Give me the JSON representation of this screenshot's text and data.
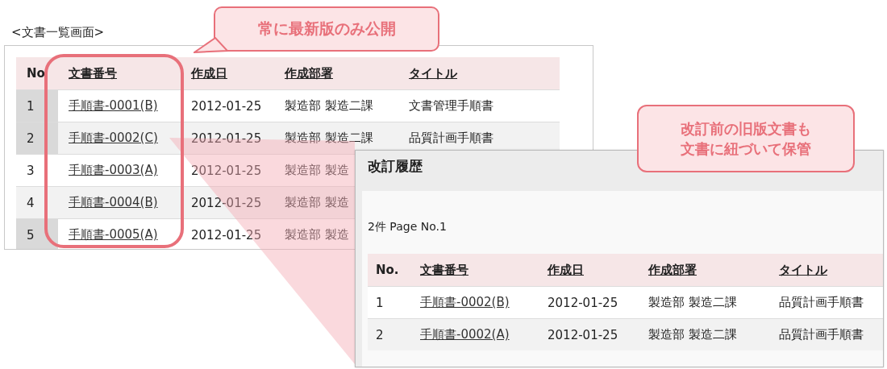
{
  "page_title": "<文書一覧画面>",
  "document_list": {
    "columns": [
      "No",
      "文書番号",
      "作成日",
      "作成部署",
      "タイトル"
    ],
    "rows": [
      {
        "no": "1",
        "doc_number": "手順書-0001(B)",
        "date": "2012-01-25",
        "department": "製造部 製造二課",
        "title": "文書管理手順書",
        "selected": true
      },
      {
        "no": "2",
        "doc_number": "手順書-0002(C)",
        "date": "2012-01-25",
        "department": "製造部 製造二課",
        "title": "品質計画手順書",
        "selected": true
      },
      {
        "no": "3",
        "doc_number": "手順書-0003(A)",
        "date": "2012-01-25",
        "department": "製造部 製造",
        "selected": false
      },
      {
        "no": "4",
        "doc_number": "手順書-0004(B)",
        "date": "2012-01-25",
        "department": "製造部 製造",
        "selected": false
      },
      {
        "no": "5",
        "doc_number": "手順書-0005(A)",
        "date": "2012-01-25",
        "department": "製造部 製造",
        "selected": true
      }
    ]
  },
  "callouts": [
    {
      "lines": [
        "常に最新版のみ公開"
      ]
    },
    {
      "lines": [
        "改訂前の旧版文書も",
        "文書に紐づいて保管"
      ]
    }
  ],
  "revision_dialog": {
    "title": "改訂履歴",
    "count_text": "2件 Page No.1",
    "columns": [
      "No.",
      "文書番号",
      "作成日",
      "作成部署",
      "タイトル"
    ],
    "rows": [
      {
        "no": "1",
        "doc_number": "手順書-0002(B)",
        "date": "2012-01-25",
        "department": "製造部 製造二課",
        "title": "品質計画手順書"
      },
      {
        "no": "2",
        "doc_number": "手順書-0002(A)",
        "date": "2012-01-25",
        "department": "製造部 製造二課",
        "title": "品質計画手順書"
      }
    ]
  }
}
